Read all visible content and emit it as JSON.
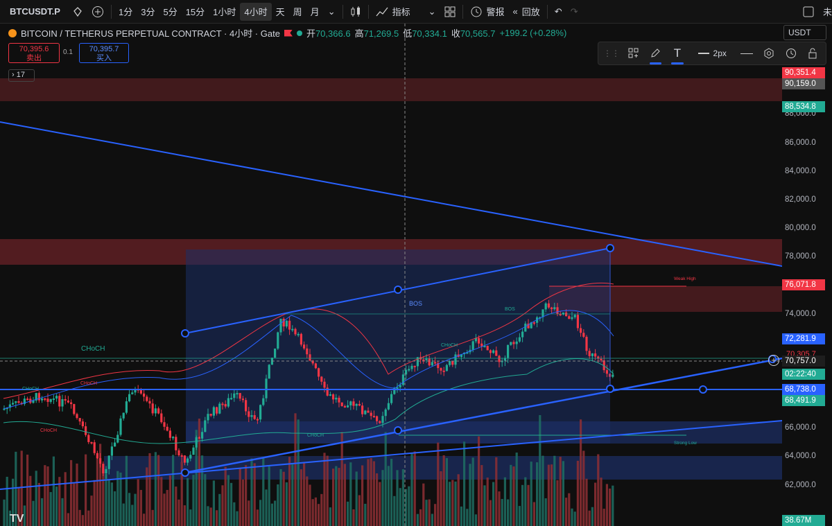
{
  "toolbar": {
    "symbol": "BTCUSDT.P",
    "intervals": [
      "1分",
      "3分",
      "5分",
      "15分",
      "1小时",
      "4小时",
      "天",
      "周",
      "月"
    ],
    "active_interval": "4小时",
    "indicators_label": "指标",
    "alert_label": "警报",
    "replay_label": "回放",
    "right_text": "未"
  },
  "legend": {
    "title": "BITCOIN / TETHERUS PERPETUAL CONTRACT · 4小时 · Gate",
    "open_label": "开",
    "open": "70,366.6",
    "high_label": "高",
    "high": "71,269.5",
    "low_label": "低",
    "low": "70,334.1",
    "close_label": "收",
    "close": "70,565.7",
    "change": "+199.2 (+0.28%)"
  },
  "trade": {
    "sell_price": "70,395.6",
    "sell_label": "卖出",
    "qty": "0.1",
    "buy_price": "70,395.7",
    "buy_label": "买入"
  },
  "currency": "USDT",
  "collapse_count": "17",
  "drawbar": {
    "width_label": "2px"
  },
  "axis_ticks": [
    "88,000.0",
    "86,000.0",
    "84,000.0",
    "82,000.0",
    "80,000.0",
    "78,000.0",
    "74,000.0",
    "66,000.0",
    "64,000.0",
    "62,000.0"
  ],
  "price_labels": [
    {
      "text": "90,351.4",
      "color": "#f23645"
    },
    {
      "text": "90,159.0",
      "color": "#555555"
    },
    {
      "text": "88,534.8",
      "color": "#22ab94"
    },
    {
      "text": "76,071.8",
      "color": "#f23645"
    },
    {
      "text": "72,281.9",
      "color": "#2962ff"
    },
    {
      "text": "70,757.0",
      "color": "#1e1e1e"
    },
    {
      "text": "02:22:40",
      "color": "#22ab94"
    },
    {
      "text": "68,738.0",
      "color": "#2962ff"
    },
    {
      "text": "68,491.9",
      "color": "#22ab94"
    },
    {
      "text": "38.67M",
      "color": "#22ab94"
    }
  ],
  "annotations": {
    "choch_main": "CHoCH",
    "choch_small": [
      "CHoCH",
      "CHoCH",
      "CHoCH",
      "CHoCH",
      "CHoCH"
    ],
    "bos": "BOS",
    "bos_small": "BOS",
    "weak_high": "Weak High",
    "strong_low": "Strong Low",
    "partial_price": "70,305.7"
  },
  "colors": {
    "up": "#22ab94",
    "down": "#f23645",
    "line": "#2962ff",
    "zone_red": "#5a1e22",
    "zone_blue": "#1c2f66"
  },
  "logo": "TV"
}
